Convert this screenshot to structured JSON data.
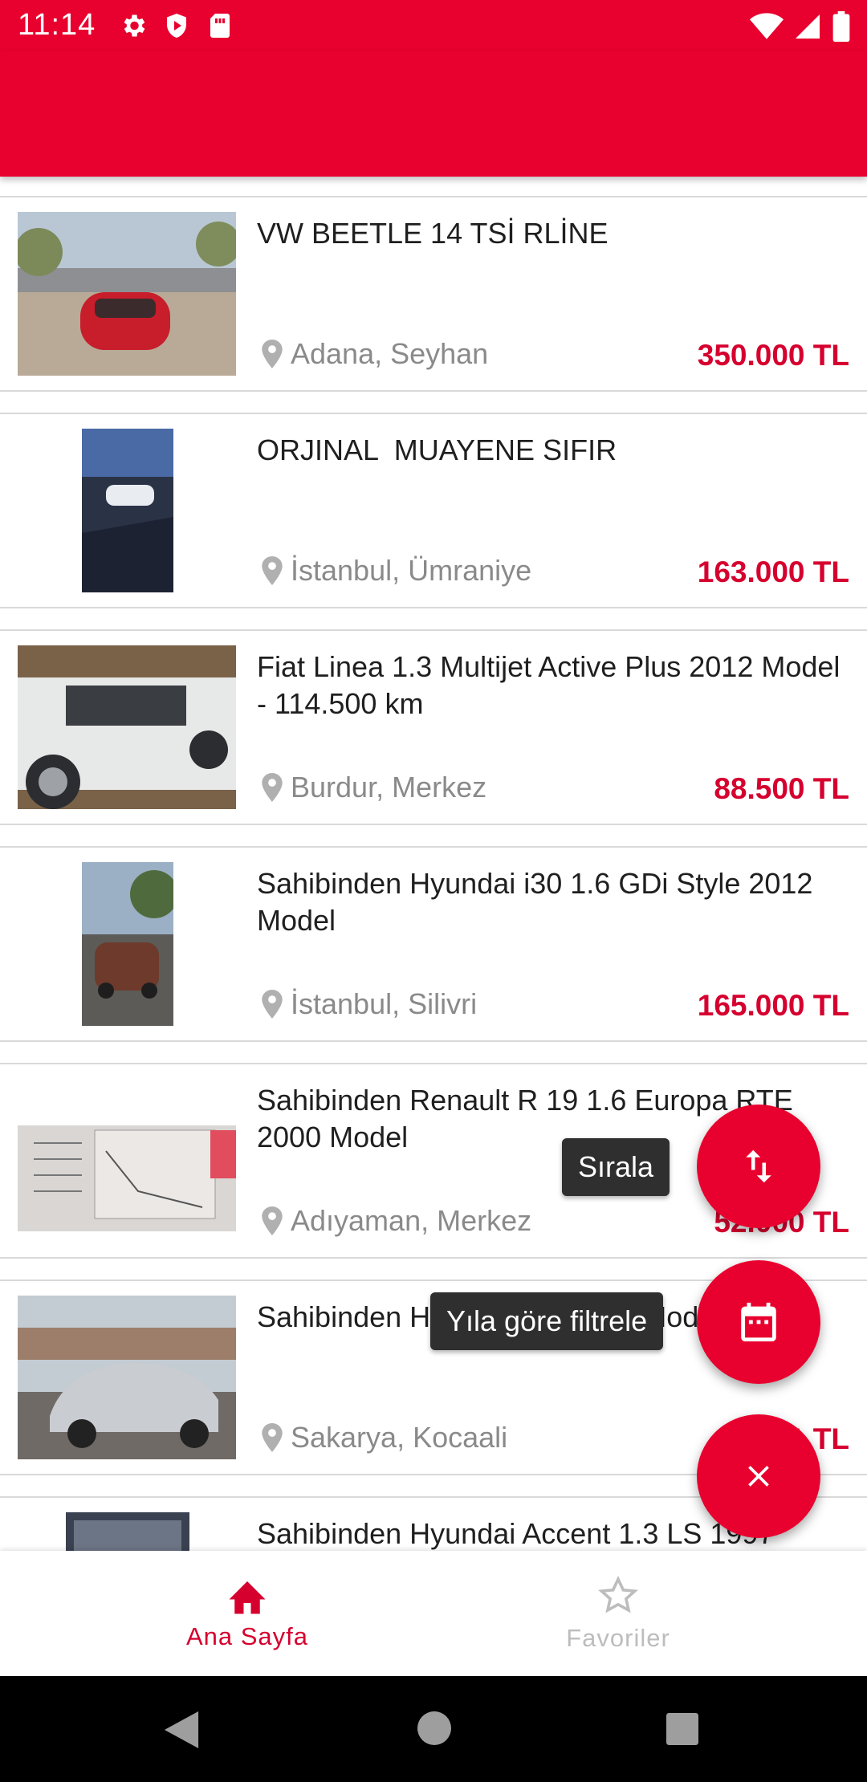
{
  "status_bar": {
    "time": "11:14",
    "left_icons": [
      "gear-icon",
      "shield-icon",
      "sim-card-icon"
    ],
    "right_icons": [
      "wifi-icon",
      "signal-icon",
      "battery-icon"
    ]
  },
  "colors": {
    "brand": "#e8002e",
    "price": "#d6002f",
    "muted": "#8a8a8a",
    "tooltip_bg": "#2f2f2f"
  },
  "listings": [
    {
      "title": "VW BEETLE 14 TSİ RLİNE",
      "location": "Adana, Seyhan",
      "price": "350.000 TL"
    },
    {
      "title": "ORJINAL  MUAYENE SIFIR",
      "location": "İstanbul, Ümraniye",
      "price": "163.000 TL"
    },
    {
      "title": "Fiat Linea 1.3 Multijet Active Plus 2012 Model - 114.500 km",
      "location": "Burdur, Merkez",
      "price": "88.500 TL"
    },
    {
      "title": "Sahibinden Hyundai i30 1.6 GDi Style 2012 Model",
      "location": "İstanbul, Silivri",
      "price": "165.000 TL"
    },
    {
      "title": "Sahibinden Renault R 19 1.6 Europa RTE 2000 Model",
      "location": "Adıyaman, Merkez",
      "price": "52.000 TL"
    },
    {
      "title": "Sahibinden H             PI 2014 Model",
      "location": "Sakarya, Kocaali",
      "price": "1       TL"
    },
    {
      "title": "Sahibinden Hyundai Accent 1.3 LS 1997",
      "location": "",
      "price": ""
    }
  ],
  "fab_menu": {
    "sort_tooltip": "Sırala",
    "year_filter_tooltip": "Yıla göre filtrele",
    "sort_icon": "swap-vertical-icon",
    "calendar_icon": "calendar-icon",
    "close_icon": "close-icon"
  },
  "bottom_nav": {
    "items": [
      {
        "label": "Ana Sayfa",
        "icon": "home-icon",
        "active": true
      },
      {
        "label": "Favoriler",
        "icon": "star-icon",
        "active": false
      }
    ]
  },
  "system_nav": [
    "back-icon",
    "home-circle-icon",
    "recents-icon"
  ]
}
